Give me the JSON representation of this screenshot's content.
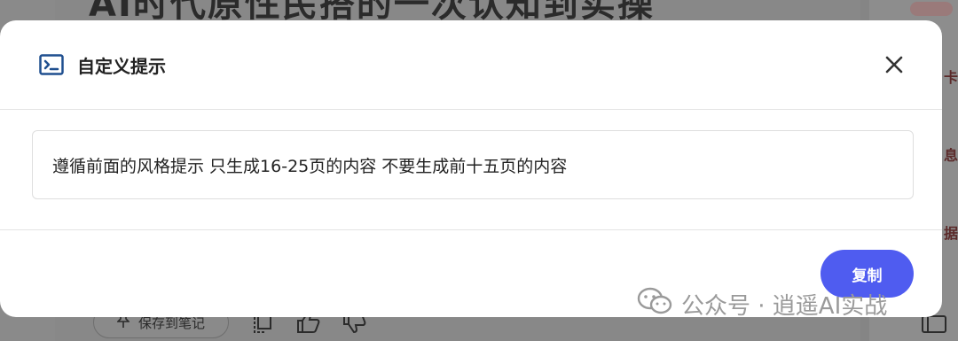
{
  "background": {
    "title_fragment": "AI时代原性民搭的一次认知到实操",
    "side_items": [
      "卡",
      "息",
      "据"
    ],
    "toolbar": {
      "save_label": "保存到笔记"
    }
  },
  "modal": {
    "title": "自定义提示",
    "icon": "terminal-icon",
    "prompt_text": "遵循前面的风格提示 只生成16-25页的内容 不要生成前十五页的内容",
    "copy_label": "复制",
    "close_icon": "close-icon"
  },
  "watermark": {
    "text": "公众号 · 逍遥AI实战",
    "icon": "wechat-icon"
  },
  "colors": {
    "accent": "#4f5cf0",
    "icon_blue": "#1f4f8f",
    "overlay": "#888888"
  }
}
